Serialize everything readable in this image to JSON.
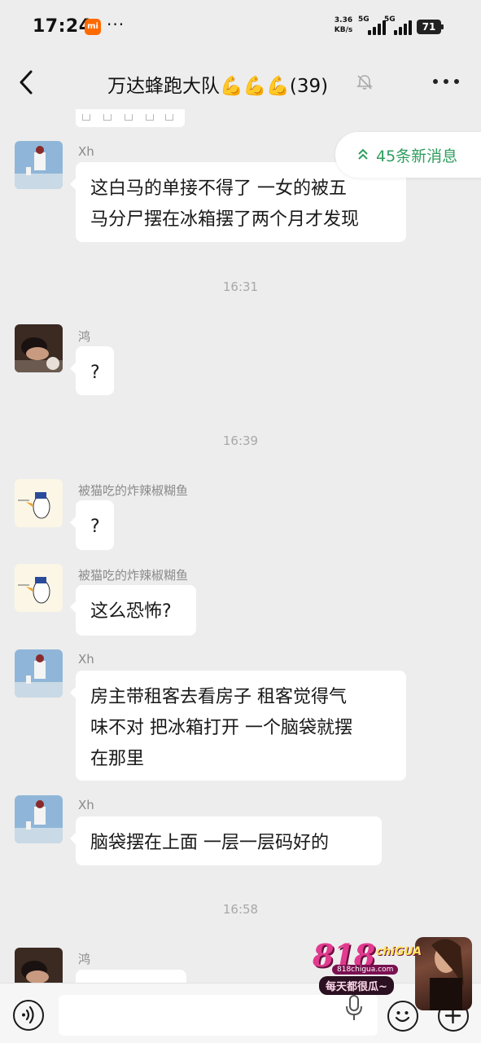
{
  "status_bar": {
    "time": "17:24",
    "carrier_badge": "mi",
    "more_dots": "···",
    "net_speed_value": "3.36",
    "net_speed_unit": "KB/s",
    "signal_1_label": "5G",
    "signal_2_label": "5G",
    "battery_level": "71"
  },
  "header": {
    "title": "万达蜂跑大队💪💪💪(39)"
  },
  "new_messages_pill": {
    "label": "45条新消息"
  },
  "messages": [
    {
      "sender": "Xh",
      "lines": [
        "这白马的单接不得了  一女的被五",
        "马分尸摆在冰箱摆了两个月才发现"
      ]
    },
    {
      "timestamp": "16:31"
    },
    {
      "sender": "鸿",
      "lines": [
        "?"
      ]
    },
    {
      "timestamp": "16:39"
    },
    {
      "sender": "被猫吃的炸辣椒糊鱼",
      "lines": [
        "?"
      ]
    },
    {
      "sender": "被猫吃的炸辣椒糊鱼",
      "lines": [
        "这么恐怖?"
      ]
    },
    {
      "sender": "Xh",
      "lines": [
        "房主带租客去看房子  租客觉得气",
        "味不对  把冰箱打开  一个脑袋就摆",
        "在那里"
      ]
    },
    {
      "sender": "Xh",
      "lines": [
        "脑袋摆在上面  一层一层码好的"
      ]
    },
    {
      "timestamp": "16:58"
    },
    {
      "sender": "鸿",
      "lines": []
    }
  ],
  "watermark": {
    "logo": "818",
    "logo_suffix": "chiGUA",
    "url": "818chigua.com",
    "slogan": "每天都很瓜~"
  },
  "colors": {
    "background": "#ededed",
    "bubble": "#ffffff",
    "accent_green": "#2f9e5f"
  }
}
